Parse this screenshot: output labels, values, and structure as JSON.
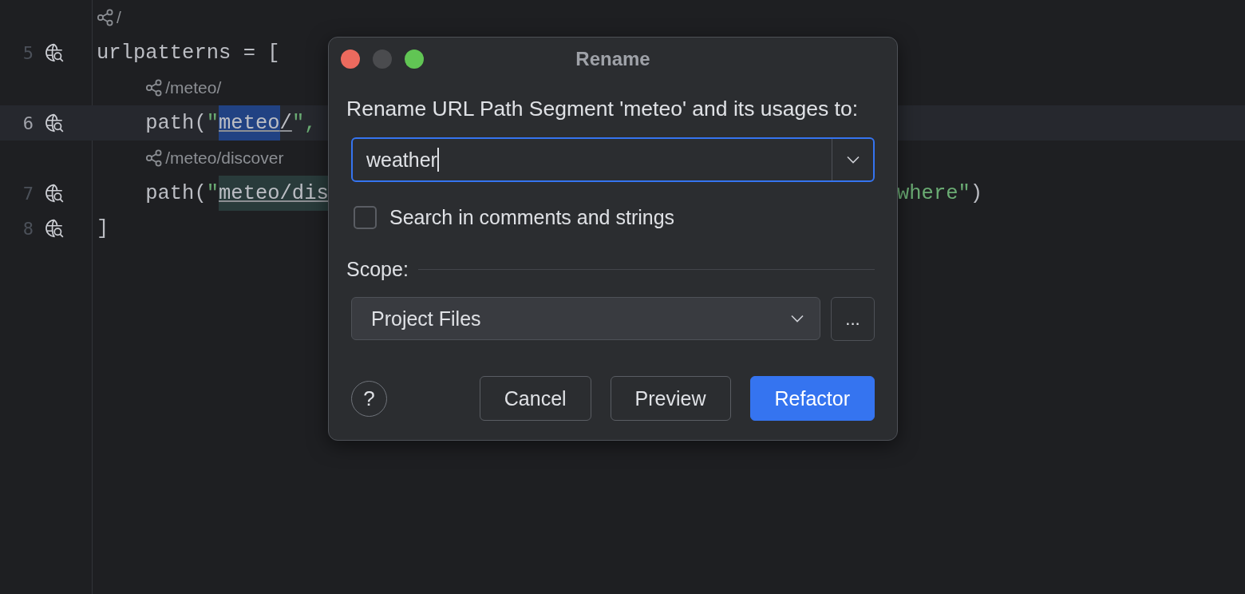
{
  "editor": {
    "lines": [
      {
        "number": "5",
        "current": false,
        "hint": "/",
        "segments": [
          {
            "kind": "plain",
            "text": "urlpatterns = ["
          }
        ]
      },
      {
        "number": "6",
        "current": true,
        "hint": "/meteo/",
        "segments": [
          {
            "kind": "plain",
            "text": "    path("
          },
          {
            "kind": "string",
            "text": "\""
          },
          {
            "kind": "selected",
            "text": "meteo"
          },
          {
            "kind": "ref",
            "text": "/"
          },
          {
            "kind": "string",
            "text": "\","
          }
        ]
      },
      {
        "number": "7",
        "current": false,
        "hint": "/meteo/discover",
        "segments": [
          {
            "kind": "plain",
            "text": "    path("
          },
          {
            "kind": "string",
            "text": "\""
          },
          {
            "kind": "match",
            "text": "meteo/dis"
          }
        ],
        "tail_segments": [
          {
            "kind": "string",
            "text": "where\""
          },
          {
            "kind": "plain",
            "text": ")"
          }
        ]
      },
      {
        "number": "8",
        "current": false,
        "segments": [
          {
            "kind": "plain",
            "text": "]"
          }
        ]
      }
    ]
  },
  "dialog": {
    "title": "Rename",
    "prompt": "Rename URL Path Segment 'meteo' and its usages to:",
    "name_field": {
      "value": "weather",
      "focused": true
    },
    "checkbox": {
      "label": "Search in comments and strings",
      "checked": false
    },
    "scope": {
      "label": "Scope:",
      "value": "Project Files",
      "more": "..."
    },
    "help": "?",
    "buttons": [
      {
        "label": "Cancel",
        "primary": false
      },
      {
        "label": "Preview",
        "primary": false
      },
      {
        "label": "Refactor",
        "primary": true
      }
    ]
  }
}
